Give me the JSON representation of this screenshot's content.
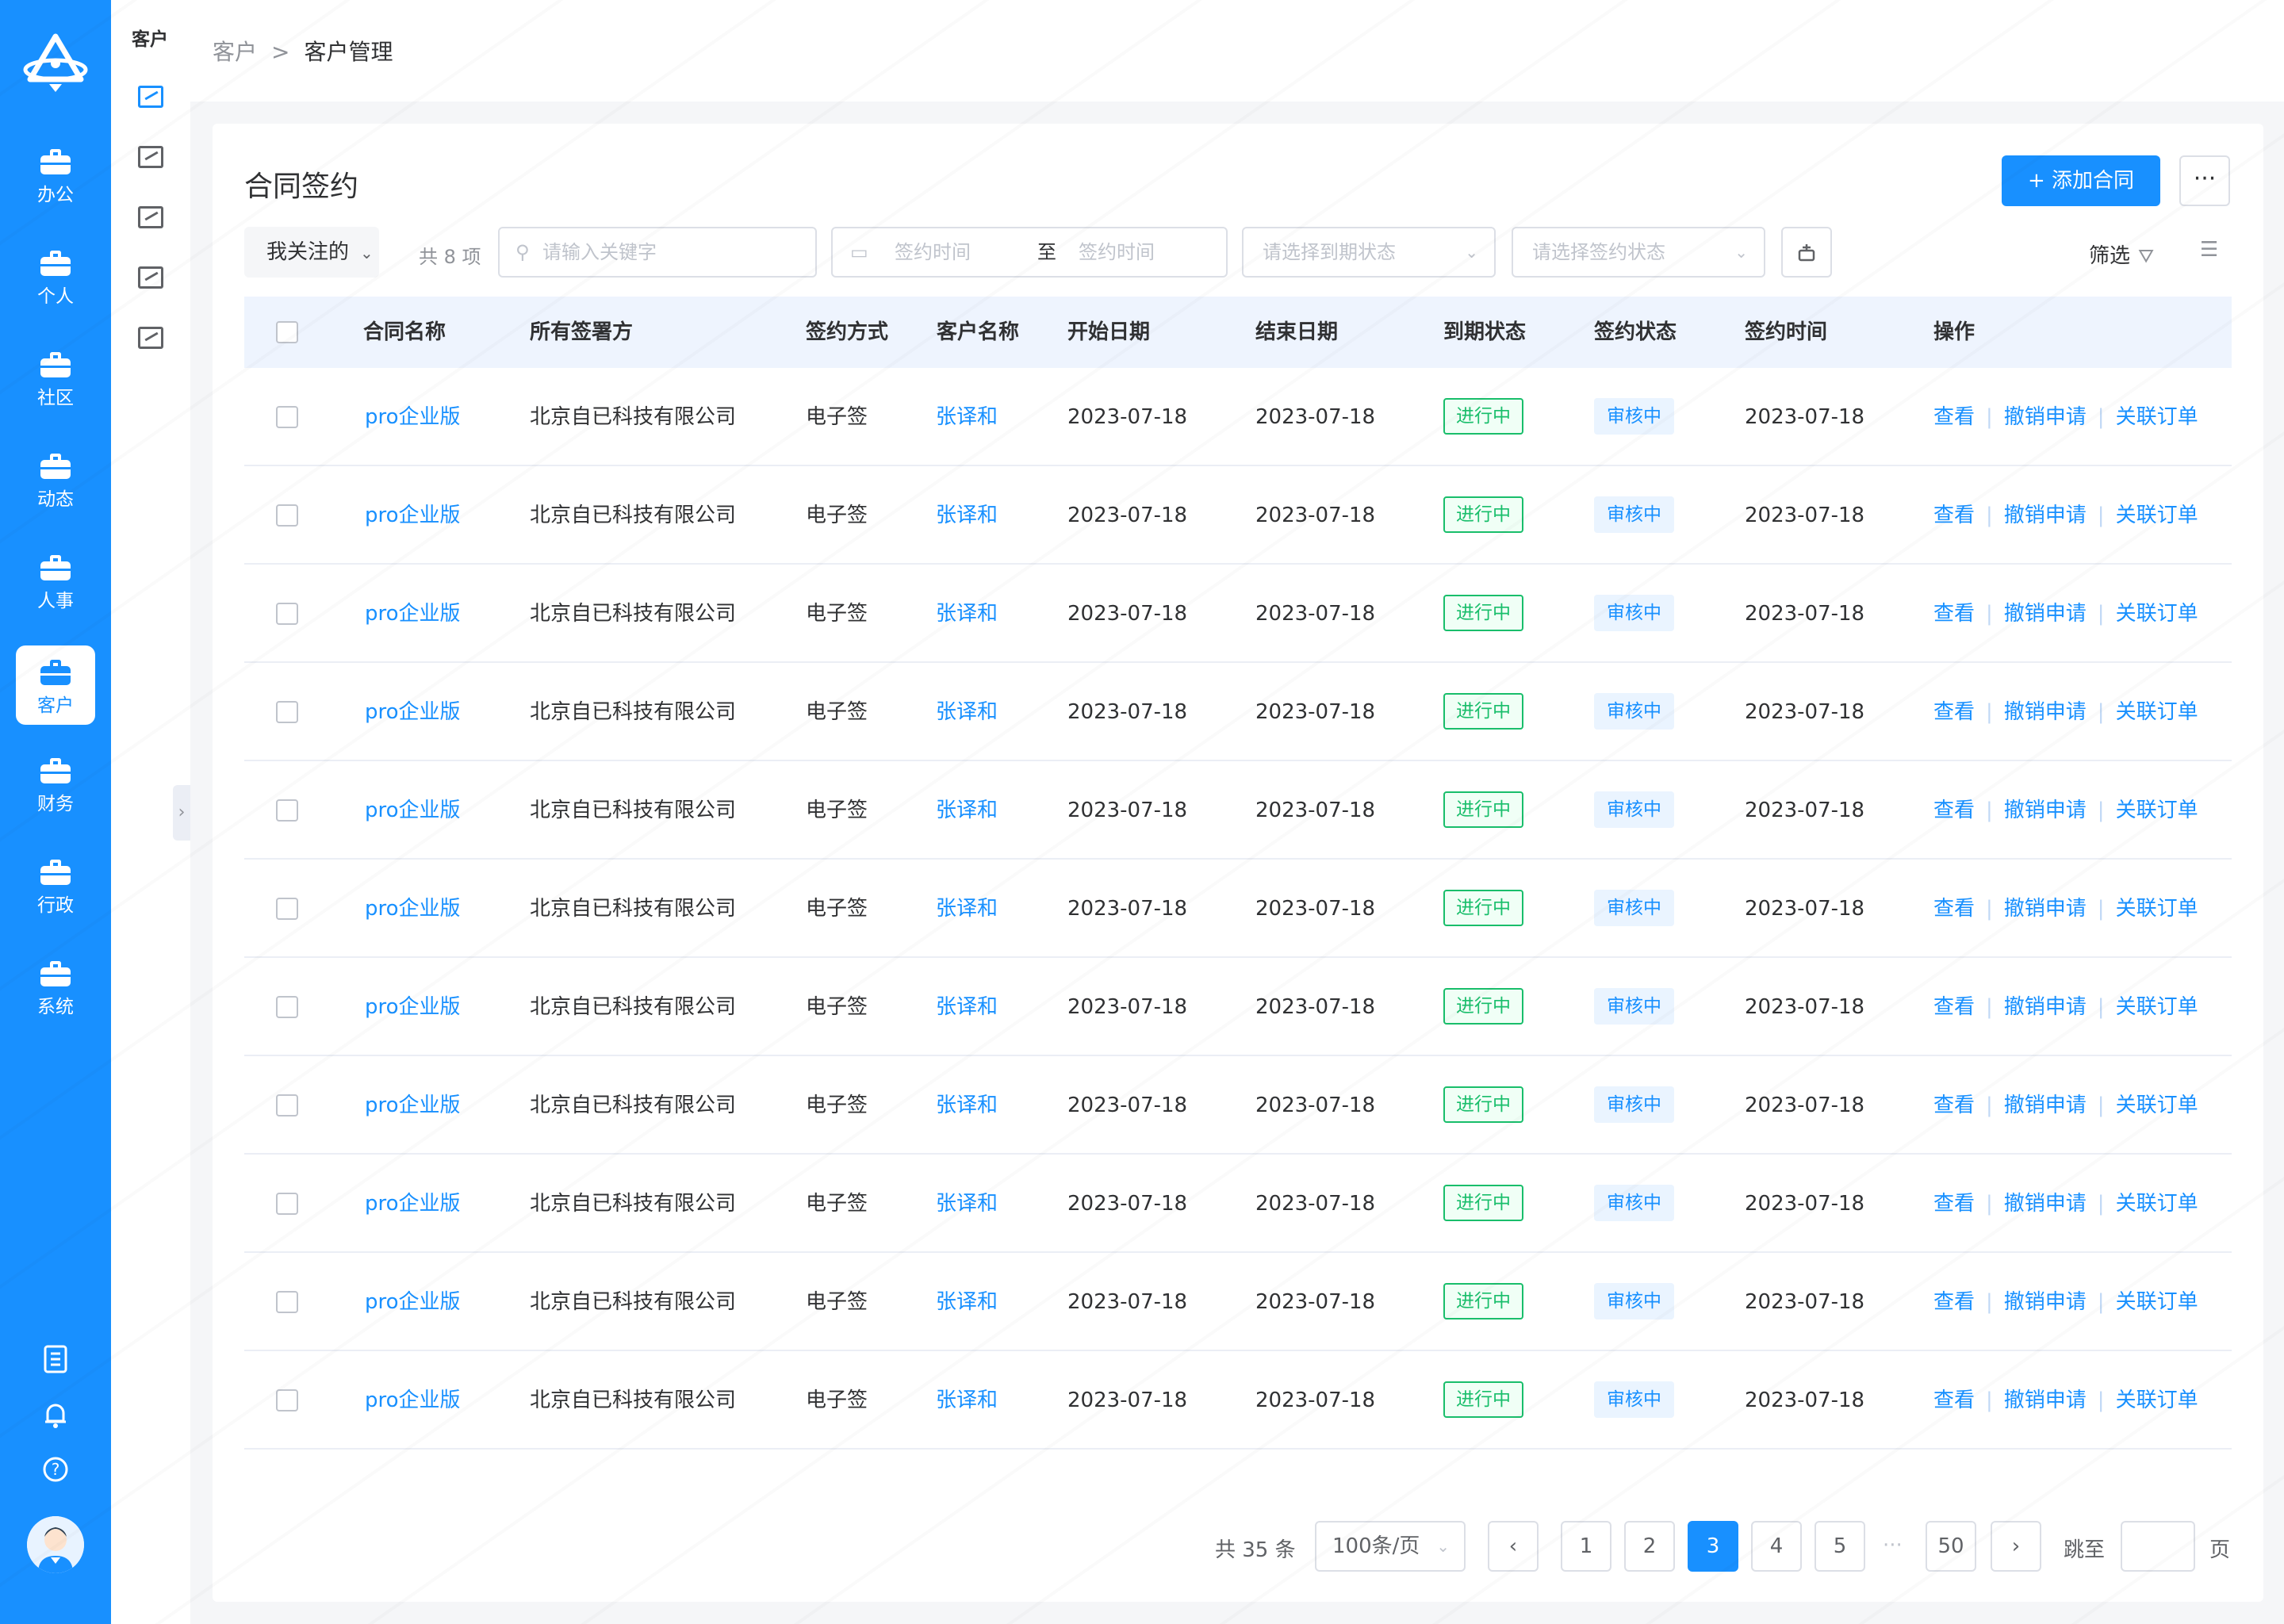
{
  "rail": {
    "items": [
      {
        "label": "办公"
      },
      {
        "label": "个人"
      },
      {
        "label": "社区"
      },
      {
        "label": "动态"
      },
      {
        "label": "人事"
      },
      {
        "label": "客户"
      },
      {
        "label": "财务"
      },
      {
        "label": "行政"
      },
      {
        "label": "系统"
      }
    ],
    "active": "客户"
  },
  "subnav": {
    "title": "客户"
  },
  "breadcrumb": {
    "level1": "客户",
    "separator": ">",
    "level2": "客户管理"
  },
  "page": {
    "title": "合同签约",
    "add_button": "+ 添加合同",
    "more_button": "···"
  },
  "toolbar": {
    "mine_dropdown": "我关注的",
    "total": "共 8 项",
    "search_placeholder": "请输入关键字",
    "date_start": "签约时间",
    "date_to": "至",
    "date_end": "签约时间",
    "expire_status_placeholder": "请选择到期状态",
    "sign_status_placeholder": "请选择签约状态",
    "filter_label": "筛选"
  },
  "table": {
    "headers": [
      "合同名称",
      "所有签署方",
      "签约方式",
      "客户名称",
      "开始日期",
      "结束日期",
      "到期状态",
      "签约状态",
      "签约时间",
      "操作"
    ],
    "rows": [
      {
        "name": "pro企业版",
        "party": "北京自已科技有限公司",
        "method": "电子签",
        "customer": "张译和",
        "start": "2023-07-18",
        "end": "2023-07-18",
        "expire": "进行中",
        "sign": "审核中",
        "signed_at": "2023-07-18",
        "op1": "查看",
        "op2": "撤销申请",
        "op3": "关联订单"
      },
      {
        "name": "pro企业版",
        "party": "北京自已科技有限公司",
        "method": "电子签",
        "customer": "张译和",
        "start": "2023-07-18",
        "end": "2023-07-18",
        "expire": "进行中",
        "sign": "审核中",
        "signed_at": "2023-07-18",
        "op1": "查看",
        "op2": "撤销申请",
        "op3": "关联订单"
      },
      {
        "name": "pro企业版",
        "party": "北京自已科技有限公司",
        "method": "电子签",
        "customer": "张译和",
        "start": "2023-07-18",
        "end": "2023-07-18",
        "expire": "进行中",
        "sign": "审核中",
        "signed_at": "2023-07-18",
        "op1": "查看",
        "op2": "撤销申请",
        "op3": "关联订单"
      },
      {
        "name": "pro企业版",
        "party": "北京自已科技有限公司",
        "method": "电子签",
        "customer": "张译和",
        "start": "2023-07-18",
        "end": "2023-07-18",
        "expire": "进行中",
        "sign": "审核中",
        "signed_at": "2023-07-18",
        "op1": "查看",
        "op2": "撤销申请",
        "op3": "关联订单"
      },
      {
        "name": "pro企业版",
        "party": "北京自已科技有限公司",
        "method": "电子签",
        "customer": "张译和",
        "start": "2023-07-18",
        "end": "2023-07-18",
        "expire": "进行中",
        "sign": "审核中",
        "signed_at": "2023-07-18",
        "op1": "查看",
        "op2": "撤销申请",
        "op3": "关联订单"
      },
      {
        "name": "pro企业版",
        "party": "北京自已科技有限公司",
        "method": "电子签",
        "customer": "张译和",
        "start": "2023-07-18",
        "end": "2023-07-18",
        "expire": "进行中",
        "sign": "审核中",
        "signed_at": "2023-07-18",
        "op1": "查看",
        "op2": "撤销申请",
        "op3": "关联订单"
      },
      {
        "name": "pro企业版",
        "party": "北京自已科技有限公司",
        "method": "电子签",
        "customer": "张译和",
        "start": "2023-07-18",
        "end": "2023-07-18",
        "expire": "进行中",
        "sign": "审核中",
        "signed_at": "2023-07-18",
        "op1": "查看",
        "op2": "撤销申请",
        "op3": "关联订单"
      },
      {
        "name": "pro企业版",
        "party": "北京自已科技有限公司",
        "method": "电子签",
        "customer": "张译和",
        "start": "2023-07-18",
        "end": "2023-07-18",
        "expire": "进行中",
        "sign": "审核中",
        "signed_at": "2023-07-18",
        "op1": "查看",
        "op2": "撤销申请",
        "op3": "关联订单"
      },
      {
        "name": "pro企业版",
        "party": "北京自已科技有限公司",
        "method": "电子签",
        "customer": "张译和",
        "start": "2023-07-18",
        "end": "2023-07-18",
        "expire": "进行中",
        "sign": "审核中",
        "signed_at": "2023-07-18",
        "op1": "查看",
        "op2": "撤销申请",
        "op3": "关联订单"
      },
      {
        "name": "pro企业版",
        "party": "北京自已科技有限公司",
        "method": "电子签",
        "customer": "张译和",
        "start": "2023-07-18",
        "end": "2023-07-18",
        "expire": "进行中",
        "sign": "审核中",
        "signed_at": "2023-07-18",
        "op1": "查看",
        "op2": "撤销申请",
        "op3": "关联订单"
      },
      {
        "name": "pro企业版",
        "party": "北京自已科技有限公司",
        "method": "电子签",
        "customer": "张译和",
        "start": "2023-07-18",
        "end": "2023-07-18",
        "expire": "进行中",
        "sign": "审核中",
        "signed_at": "2023-07-18",
        "op1": "查看",
        "op2": "撤销申请",
        "op3": "关联订单"
      }
    ]
  },
  "pagination": {
    "total": "共 35 条",
    "page_size": "100条/页",
    "pages": [
      "1",
      "2",
      "3",
      "4",
      "5"
    ],
    "current": "3",
    "ellipsis": "···",
    "last": "50",
    "jump_label": "跳至",
    "jump_suffix": "页"
  },
  "colors": {
    "primary": "#1890ff",
    "success": "#19be6b",
    "rail": "#1890ff"
  },
  "icons": [
    "briefcase-icon",
    "search-icon",
    "calendar-icon",
    "filter-icon",
    "columns-icon",
    "bell-icon",
    "help-icon",
    "notebook-icon"
  ]
}
